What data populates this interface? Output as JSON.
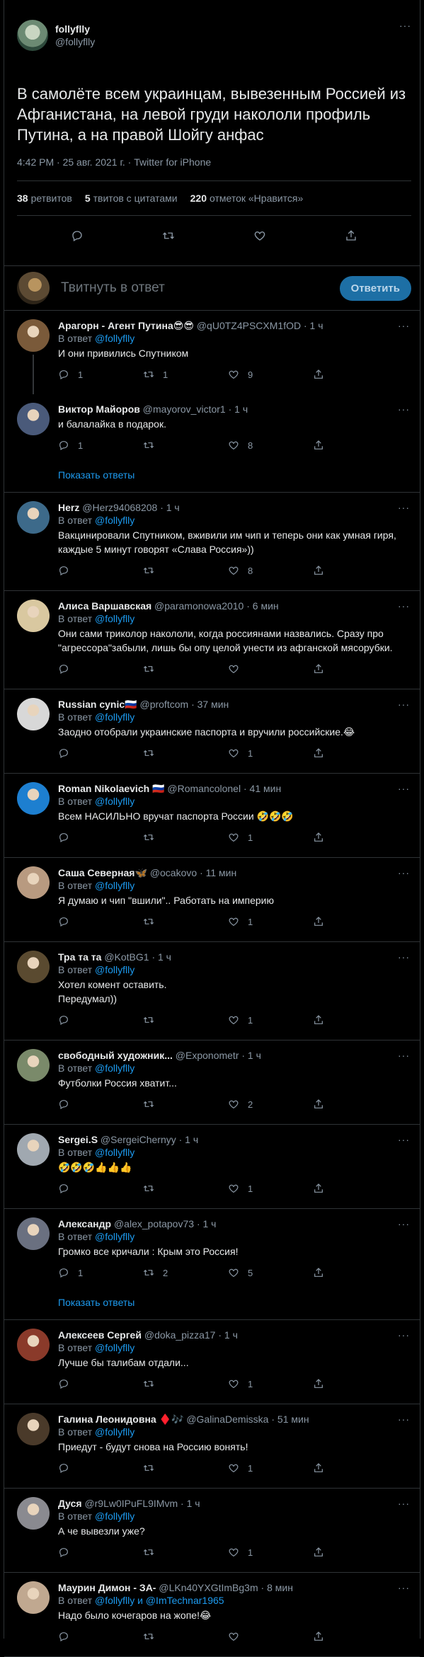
{
  "main": {
    "name": "follyflly",
    "handle": "@follyflly",
    "text": "В самолёте всем украинцам, вывезенным Россией из Афганистана, на левой груди накололи профиль Путина, а на правой Шойгу анфас",
    "meta": "4:42 PM · 25 авг. 2021 г. · Twitter for iPhone",
    "retweets_count": "38",
    "retweets_label": "ретвитов",
    "quotes_count": "5",
    "quotes_label": "твитов с цитатами",
    "likes_count": "220",
    "likes_label": "отметок «Нравится»"
  },
  "reply_box": {
    "placeholder": "Твитнуть в ответ",
    "button": "Ответить"
  },
  "replies": [
    {
      "name": "Арагорн - Агент Путина😎😎",
      "handle": "@qU0TZ4PSCXM1fOD",
      "time": "· 1 ч",
      "to_label": "В ответ",
      "to": "@follyflly",
      "text": "И они привились Спутником",
      "reply": "1",
      "rt": "1",
      "like": "9",
      "avatar": "#7a5a3a"
    },
    {
      "name": "Виктор Майоров",
      "handle": "@mayorov_victor1",
      "time": "· 1 ч",
      "to_label": "",
      "to": "",
      "text": "и балалайка в подарок.",
      "reply": "1",
      "rt": "",
      "like": "8",
      "avatar": "#4a5a7a"
    },
    {
      "name": "Herz",
      "handle": "@Herz94068208",
      "time": "· 1 ч",
      "to_label": "В ответ",
      "to": "@follyflly",
      "text": "Вакцинировали Спутником, вживили им чип и теперь они как умная гиря, каждые 5 минут говорят «Слава Россия»))",
      "reply": "",
      "rt": "",
      "like": "8",
      "avatar": "#3d6a8a"
    },
    {
      "name": "Алиса Варшавская",
      "handle": "@paramonowa2010",
      "time": "· 6 мин",
      "to_label": "В ответ",
      "to": "@follyflly",
      "text": "Они сами триколор накололи, когда россиянами назвались. Сразу про \"агрессора\"забыли, лишь бы опу целой унести из афганской мясорубки.",
      "reply": "",
      "rt": "",
      "like": "",
      "avatar": "#d9c8a0"
    },
    {
      "name": "Russian cynic🇷🇺",
      "handle": "@proftcom",
      "time": "· 37 мин",
      "to_label": "В ответ",
      "to": "@follyflly",
      "text": "Заодно отобрали украинские паспорта и вручили российские.😂",
      "reply": "",
      "rt": "",
      "like": "1",
      "avatar": "#d8d8d8"
    },
    {
      "name": "Roman Nikolaevich 🇷🇺",
      "handle": "@Romancolonel",
      "time": "· 41 мин",
      "to_label": "В ответ",
      "to": "@follyflly",
      "text": "Всем НАСИЛЬНО вручат паспорта России 🤣🤣🤣",
      "reply": "",
      "rt": "",
      "like": "1",
      "avatar": "#1d7fd0"
    },
    {
      "name": "Саша Северная🦋",
      "handle": "@ocakovo",
      "time": "· 11 мин",
      "to_label": "В ответ",
      "to": "@follyflly",
      "text": "Я думаю и чип \"вшили\".. Работать на империю",
      "reply": "",
      "rt": "",
      "like": "1",
      "avatar": "#b89a80"
    },
    {
      "name": "Тра та та",
      "handle": "@KotBG1",
      "time": "· 1 ч",
      "to_label": "В ответ",
      "to": "@follyflly",
      "text": "Хотел комент оставить.\nПередумал))",
      "reply": "",
      "rt": "",
      "like": "1",
      "avatar": "#5a4a30"
    },
    {
      "name": "свободный художник...",
      "handle": "@Exponometr",
      "time": "· 1 ч",
      "to_label": "В ответ",
      "to": "@follyflly",
      "text": "Футболки Россия хватит...",
      "reply": "",
      "rt": "",
      "like": "2",
      "avatar": "#7a8a6a"
    },
    {
      "name": "Sergei.S",
      "handle": "@SergeiChernyy",
      "time": "· 1 ч",
      "to_label": "В ответ",
      "to": "@follyflly",
      "text": "🤣🤣🤣👍👍👍",
      "reply": "",
      "rt": "",
      "like": "1",
      "avatar": "#a0a8b0"
    },
    {
      "name": "Александр",
      "handle": "@alex_potapov73",
      "time": "· 1 ч",
      "to_label": "В ответ",
      "to": "@follyflly",
      "text": "Громко все кричали : Крым это Россия!",
      "reply": "1",
      "rt": "2",
      "like": "5",
      "avatar": "#6a7080"
    },
    {
      "name": "Алексеев Сергей",
      "handle": "@doka_pizza17",
      "time": "· 1 ч",
      "to_label": "В ответ",
      "to": "@follyflly",
      "text": "Лучше бы талибам отдали...",
      "reply": "",
      "rt": "",
      "like": "1",
      "avatar": "#8a3a2a"
    },
    {
      "name": "Галина Леонидовна ♦️🎶",
      "handle": "@GalinaDemisska",
      "time": "· 51 мин",
      "to_label": "В ответ",
      "to": "@follyflly",
      "text": "Приедут - будут снова на Россию вонять!",
      "reply": "",
      "rt": "",
      "like": "1",
      "avatar": "#4a3a2a"
    },
    {
      "name": "Дуся",
      "handle": "@r9Lw0IPuFL9IMvm",
      "time": "· 1 ч",
      "to_label": "В ответ",
      "to": "@follyflly",
      "text": "А че вывезли уже?",
      "reply": "",
      "rt": "",
      "like": "1",
      "avatar": "#8a8a90"
    },
    {
      "name": "Маурин Димон - ЗА-",
      "handle": "@LKn40YXGtImBg3m",
      "time": "· 8 мин",
      "to_label": "В ответ",
      "to": "@follyflly и @ImTechnar1965",
      "text": "Надо было кочегаров на жопе!😂",
      "reply": "",
      "rt": "",
      "like": "",
      "avatar": "#c0a890"
    }
  ],
  "show_replies": "Показать ответы",
  "colors": {
    "accent": "#1d9bf0",
    "background": "#000000",
    "divider": "#2f3336",
    "muted": "#8b98a5"
  },
  "icons": [
    "more-icon",
    "reply-icon",
    "retweet-icon",
    "like-icon",
    "share-icon"
  ]
}
